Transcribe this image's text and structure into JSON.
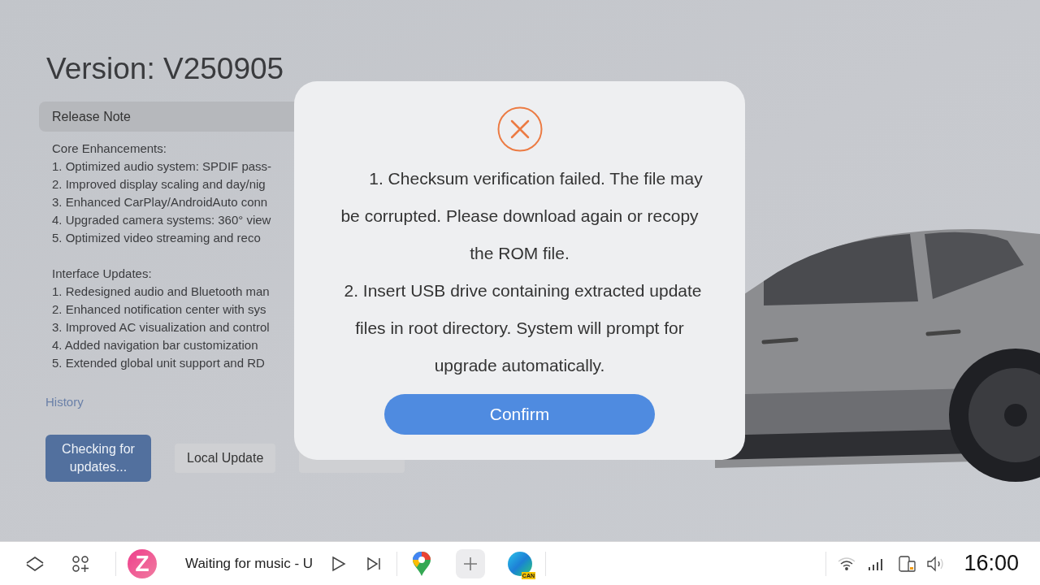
{
  "version_title": "Version: V250905",
  "release_note": {
    "header": "Release Note",
    "sections": [
      {
        "heading": "Core Enhancements:",
        "items": [
          "1. Optimized audio system: SPDIF pass-",
          "2. Improved display scaling and day/nig",
          "3. Enhanced CarPlay/AndroidAuto conn",
          "4. Upgraded camera systems: 360° view",
          "5. Optimized video streaming and reco"
        ]
      },
      {
        "heading": "Interface Updates:",
        "items": [
          "1. Redesigned audio and Bluetooth man",
          "2. Enhanced notification center with sys",
          "3. Improved AC visualization and control",
          "4. Added navigation bar customization",
          "5. Extended global unit support and RD"
        ]
      }
    ]
  },
  "history_link": "History",
  "buttons": [
    {
      "label": "Checking for updates...",
      "kind": "primary"
    },
    {
      "label": "Local Update",
      "kind": "secondary"
    },
    {
      "kind": "covered"
    }
  ],
  "dialog": {
    "paragraphs": [
      "1. Checksum verification failed. The file may be corrupted. Please download again or recopy the ROM file.",
      "2. Insert USB drive containing extracted update files in root directory. System will prompt for upgrade automatically."
    ],
    "confirm": "Confirm"
  },
  "taskbar": {
    "app_logo": "Z",
    "music": "Waiting for music - U",
    "can_badge": "CAN",
    "time": "16:00"
  }
}
